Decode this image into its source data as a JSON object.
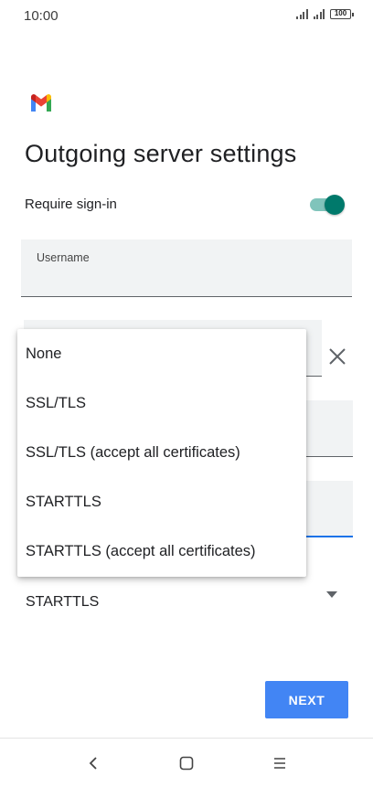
{
  "status_bar": {
    "time": "10:00",
    "battery": "100"
  },
  "page": {
    "title": "Outgoing server settings"
  },
  "signin": {
    "label": "Require sign-in",
    "enabled": true
  },
  "username": {
    "label": "Username"
  },
  "dropdown": {
    "options": [
      "None",
      "SSL/TLS",
      "SSL/TLS (accept all certificates)",
      "STARTTLS",
      "STARTTLS (accept all certificates)"
    ]
  },
  "security": {
    "selected": "STARTTLS"
  },
  "actions": {
    "next_label": "NEXT"
  },
  "colors": {
    "accent": "#00796b",
    "primary_button": "#4285f4",
    "focus_underline": "#1a73e8"
  },
  "icons": {
    "logo": "gmail-icon",
    "clear": "close-icon",
    "dropdown": "dropdown-arrow-icon",
    "back": "back-icon",
    "home": "home-icon",
    "recent": "recent-apps-icon"
  }
}
